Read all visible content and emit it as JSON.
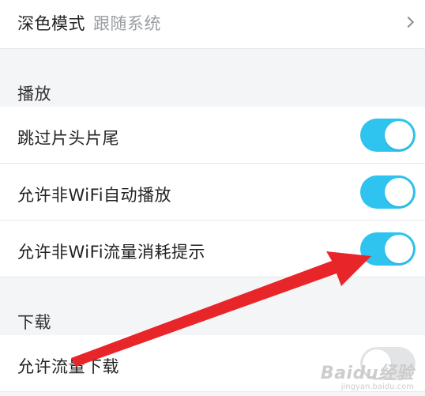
{
  "display": {
    "label": "深色模式",
    "value": "跟随系统"
  },
  "playback": {
    "section_title": "播放",
    "items": [
      {
        "label": "跳过片头片尾",
        "on": true
      },
      {
        "label": "允许非WiFi自动播放",
        "on": true
      },
      {
        "label": "允许非WiFi流量消耗提示",
        "on": true
      }
    ]
  },
  "download": {
    "section_title": "下载",
    "items": [
      {
        "label": "允许流量下载",
        "on": false
      }
    ]
  },
  "colors": {
    "toggle_on": "#2ec4ef",
    "toggle_off": "#e3e4e6",
    "arrow": "#e8262a"
  },
  "watermark": {
    "main": "Baidu经验",
    "sub": "jingyan.baidu.com"
  }
}
